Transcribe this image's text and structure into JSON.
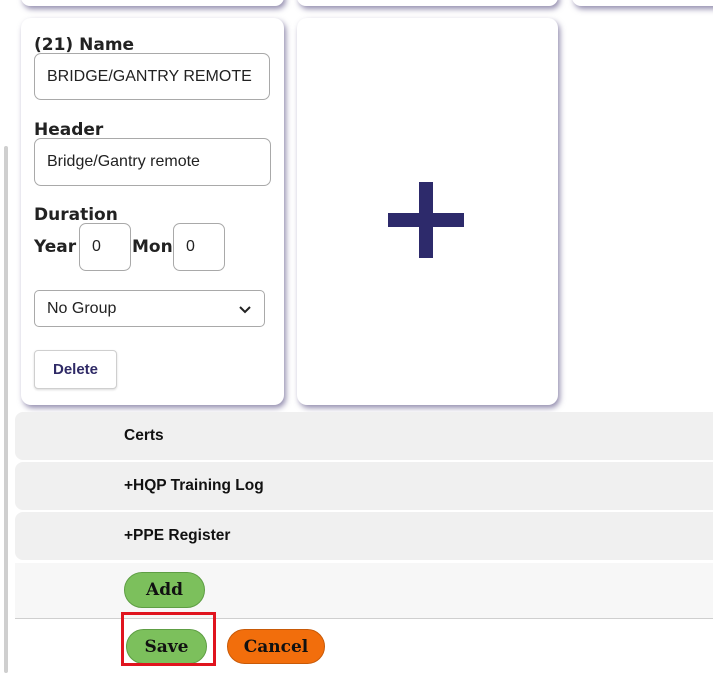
{
  "card": {
    "name_label": "(21) Name",
    "name_value": "BRIDGE/GANTRY REMOTE OPERATOR",
    "header_label": "Header",
    "header_value": "Bridge/Gantry remote",
    "duration_label": "Duration",
    "year_label": "Year",
    "year_value": "0",
    "mon_label": "Mon",
    "mon_value": "0",
    "group_selected": "No Group",
    "delete_label": "Delete"
  },
  "add_card": {
    "icon": "plus-icon",
    "color": "#2d2a6b"
  },
  "sections": [
    {
      "label": "Certs"
    },
    {
      "label": "+HQP Training Log"
    },
    {
      "label": "+PPE Register"
    }
  ],
  "actions": {
    "add_label": "Add",
    "save_label": "Save",
    "cancel_label": "Cancel"
  },
  "colors": {
    "green": "#7cc05c",
    "orange": "#f26e0c",
    "highlight": "#e0141e",
    "accent": "#2d2a6b"
  }
}
